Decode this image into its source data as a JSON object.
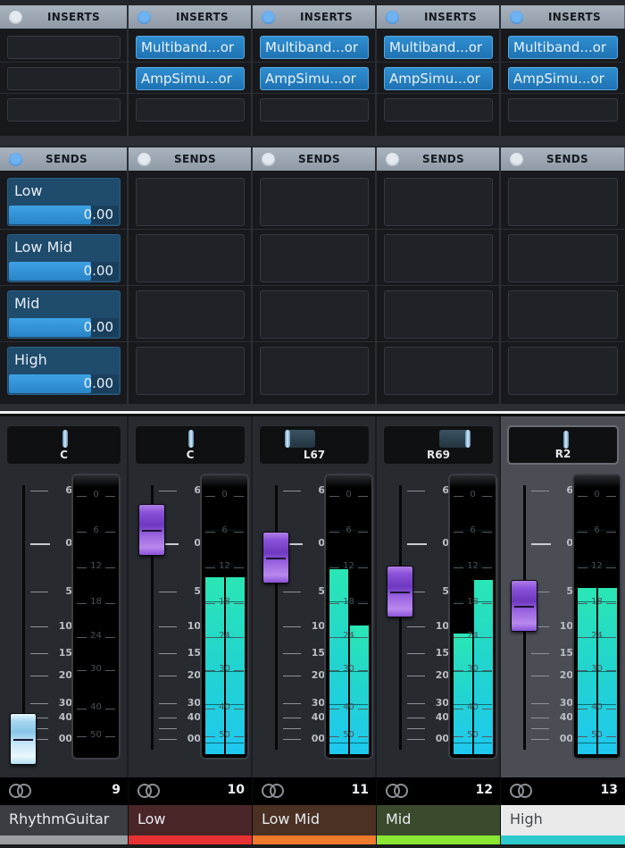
{
  "inserts": {
    "header_label": "INSERTS",
    "channels": [
      {
        "active": false,
        "slots": [
          "",
          "",
          ""
        ]
      },
      {
        "active": true,
        "slots": [
          "Multiband...or",
          "AmpSimu...or",
          ""
        ]
      },
      {
        "active": true,
        "slots": [
          "Multiband...or",
          "AmpSimu...or",
          ""
        ]
      },
      {
        "active": true,
        "slots": [
          "Multiband...or",
          "AmpSimu...or",
          ""
        ]
      },
      {
        "active": true,
        "slots": [
          "Multiband...or",
          "AmpSimu...or",
          ""
        ]
      }
    ]
  },
  "sends": {
    "header_label": "SENDS",
    "channels": [
      {
        "active": true,
        "sends": [
          {
            "name": "Low",
            "value": "0.00",
            "level": 0.75
          },
          {
            "name": "Low Mid",
            "value": "0.00",
            "level": 0.75
          },
          {
            "name": "Mid",
            "value": "0.00",
            "level": 0.75
          },
          {
            "name": "High",
            "value": "0.00",
            "level": 0.75
          }
        ]
      },
      {
        "active": false,
        "sends": []
      },
      {
        "active": false,
        "sends": []
      },
      {
        "active": false,
        "sends": []
      },
      {
        "active": false,
        "sends": []
      }
    ]
  },
  "fader_scale": [
    "6",
    "0",
    "5",
    "10",
    "15",
    "20",
    "30",
    "40",
    "00"
  ],
  "meter_scale": [
    "0",
    "6",
    "12",
    "18",
    "24",
    "30",
    "40",
    "50"
  ],
  "channels": [
    {
      "number": "9",
      "name": "RhythmGuitar",
      "pan_label": "C",
      "pan": 0,
      "fader_db": "-inf",
      "fader_style": "light",
      "meter_left": 0,
      "meter_right": 0,
      "name_bg": "#3a3d42",
      "name_color": "#e8ecef",
      "color": "#9a9da1",
      "selected": false
    },
    {
      "number": "10",
      "name": "Low",
      "pan_label": "C",
      "pan": 0,
      "fader_db": "1.5",
      "fader_style": "purple",
      "meter_left": 0.66,
      "meter_right": 0.66,
      "name_bg": "#4b2628",
      "name_color": "#e8ecef",
      "color": "#e63232",
      "selected": false
    },
    {
      "number": "11",
      "name": "Low Mid",
      "pan_label": "L67",
      "pan": -0.67,
      "fader_db": "-1.5",
      "fader_style": "purple",
      "meter_left": 0.69,
      "meter_right": 0.48,
      "name_bg": "#4a3124",
      "name_color": "#e8ecef",
      "color": "#ee7a2c",
      "selected": false
    },
    {
      "number": "12",
      "name": "Mid",
      "pan_label": "R69",
      "pan": 0.69,
      "fader_db": "-5",
      "fader_style": "purple",
      "meter_left": 0.45,
      "meter_right": 0.65,
      "name_bg": "#3a4a2c",
      "name_color": "#e8ecef",
      "color": "#8ae632",
      "selected": false
    },
    {
      "number": "13",
      "name": "High",
      "pan_label": "R2",
      "pan": 0.02,
      "fader_db": "-7",
      "fader_style": "purple",
      "meter_left": 0.62,
      "meter_right": 0.62,
      "name_bg": "#eaeaea",
      "name_color": "#45484c",
      "color": "#2ec9cc",
      "selected": true
    }
  ]
}
